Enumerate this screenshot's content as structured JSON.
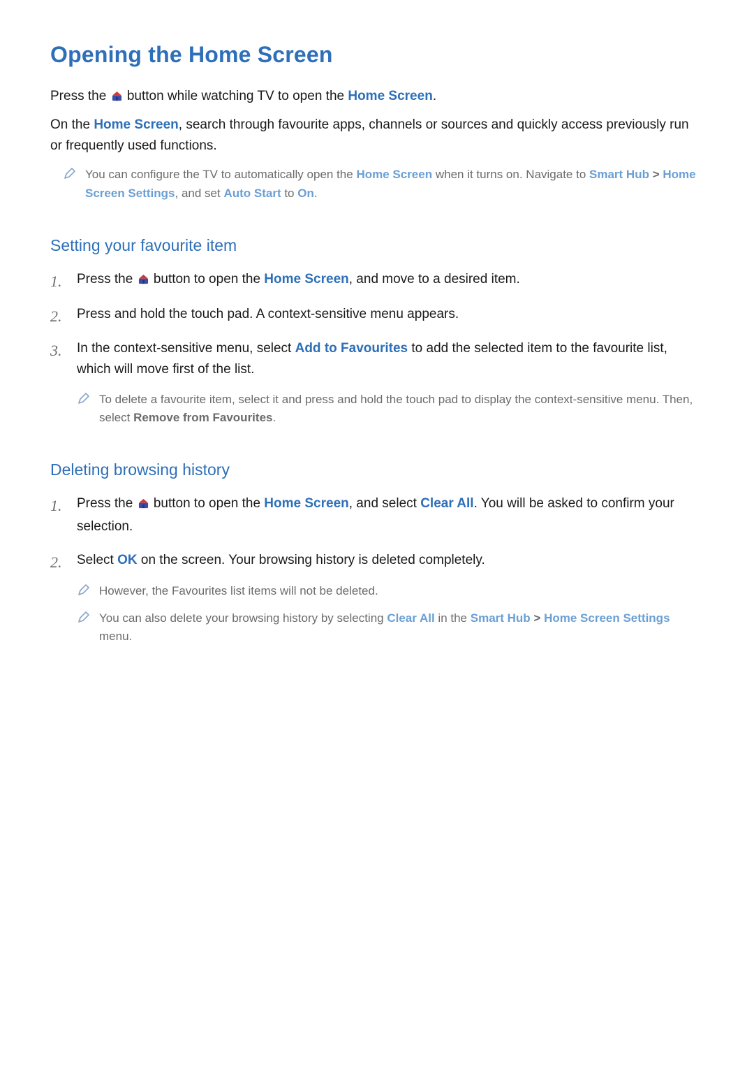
{
  "title": "Opening the Home Screen",
  "intro": {
    "p1a": "Press the ",
    "p1b": " button while watching TV to open the ",
    "p1_link": "Home Screen",
    "p1c": ".",
    "p2a": "On the ",
    "p2_link": "Home Screen",
    "p2b": ", search through favourite apps, channels or sources and quickly access previously run or frequently used functions."
  },
  "intro_note": {
    "a": "You can configure the TV to automatically open the ",
    "home_screen": "Home Screen",
    "b": " when it turns on. Navigate to ",
    "smart_hub": "Smart Hub",
    "sep1": " > ",
    "home_settings": "Home Screen Settings",
    "c": ", and set ",
    "auto_start": "Auto Start",
    "d": " to ",
    "on": "On",
    "e": "."
  },
  "sub1": {
    "heading": "Setting your favourite item",
    "steps": {
      "s1a": "Press the ",
      "s1b": " button to open the ",
      "s1_link": "Home Screen",
      "s1c": ", and move to a desired item.",
      "s2": "Press and hold the touch pad. A context-sensitive menu appears.",
      "s3a": "In the context-sensitive menu, select ",
      "s3_link": "Add to Favourites",
      "s3b": " to add the selected item to the favourite list, which will move first of the list."
    },
    "note": {
      "a": "To delete a favourite item, select it and press and hold the touch pad to display the context-sensitive menu. Then, select ",
      "remove": "Remove from Favourites",
      "b": "."
    }
  },
  "sub2": {
    "heading": "Deleting browsing history",
    "steps": {
      "s1a": "Press the ",
      "s1b": " button to open the ",
      "s1_link1": "Home Screen",
      "s1c": ", and select ",
      "s1_link2": "Clear All",
      "s1d": ". You will be asked to confirm your selection.",
      "s2a": "Select ",
      "s2_link": "OK",
      "s2b": " on the screen. Your browsing history is deleted completely."
    },
    "note1": "However, the Favourites list items will not be deleted.",
    "note2": {
      "a": "You can also delete your browsing history by selecting ",
      "clear_all": "Clear All",
      "b": " in the ",
      "smart_hub": "Smart Hub",
      "sep": " > ",
      "home_settings": "Home Screen Settings",
      "c": " menu."
    }
  }
}
